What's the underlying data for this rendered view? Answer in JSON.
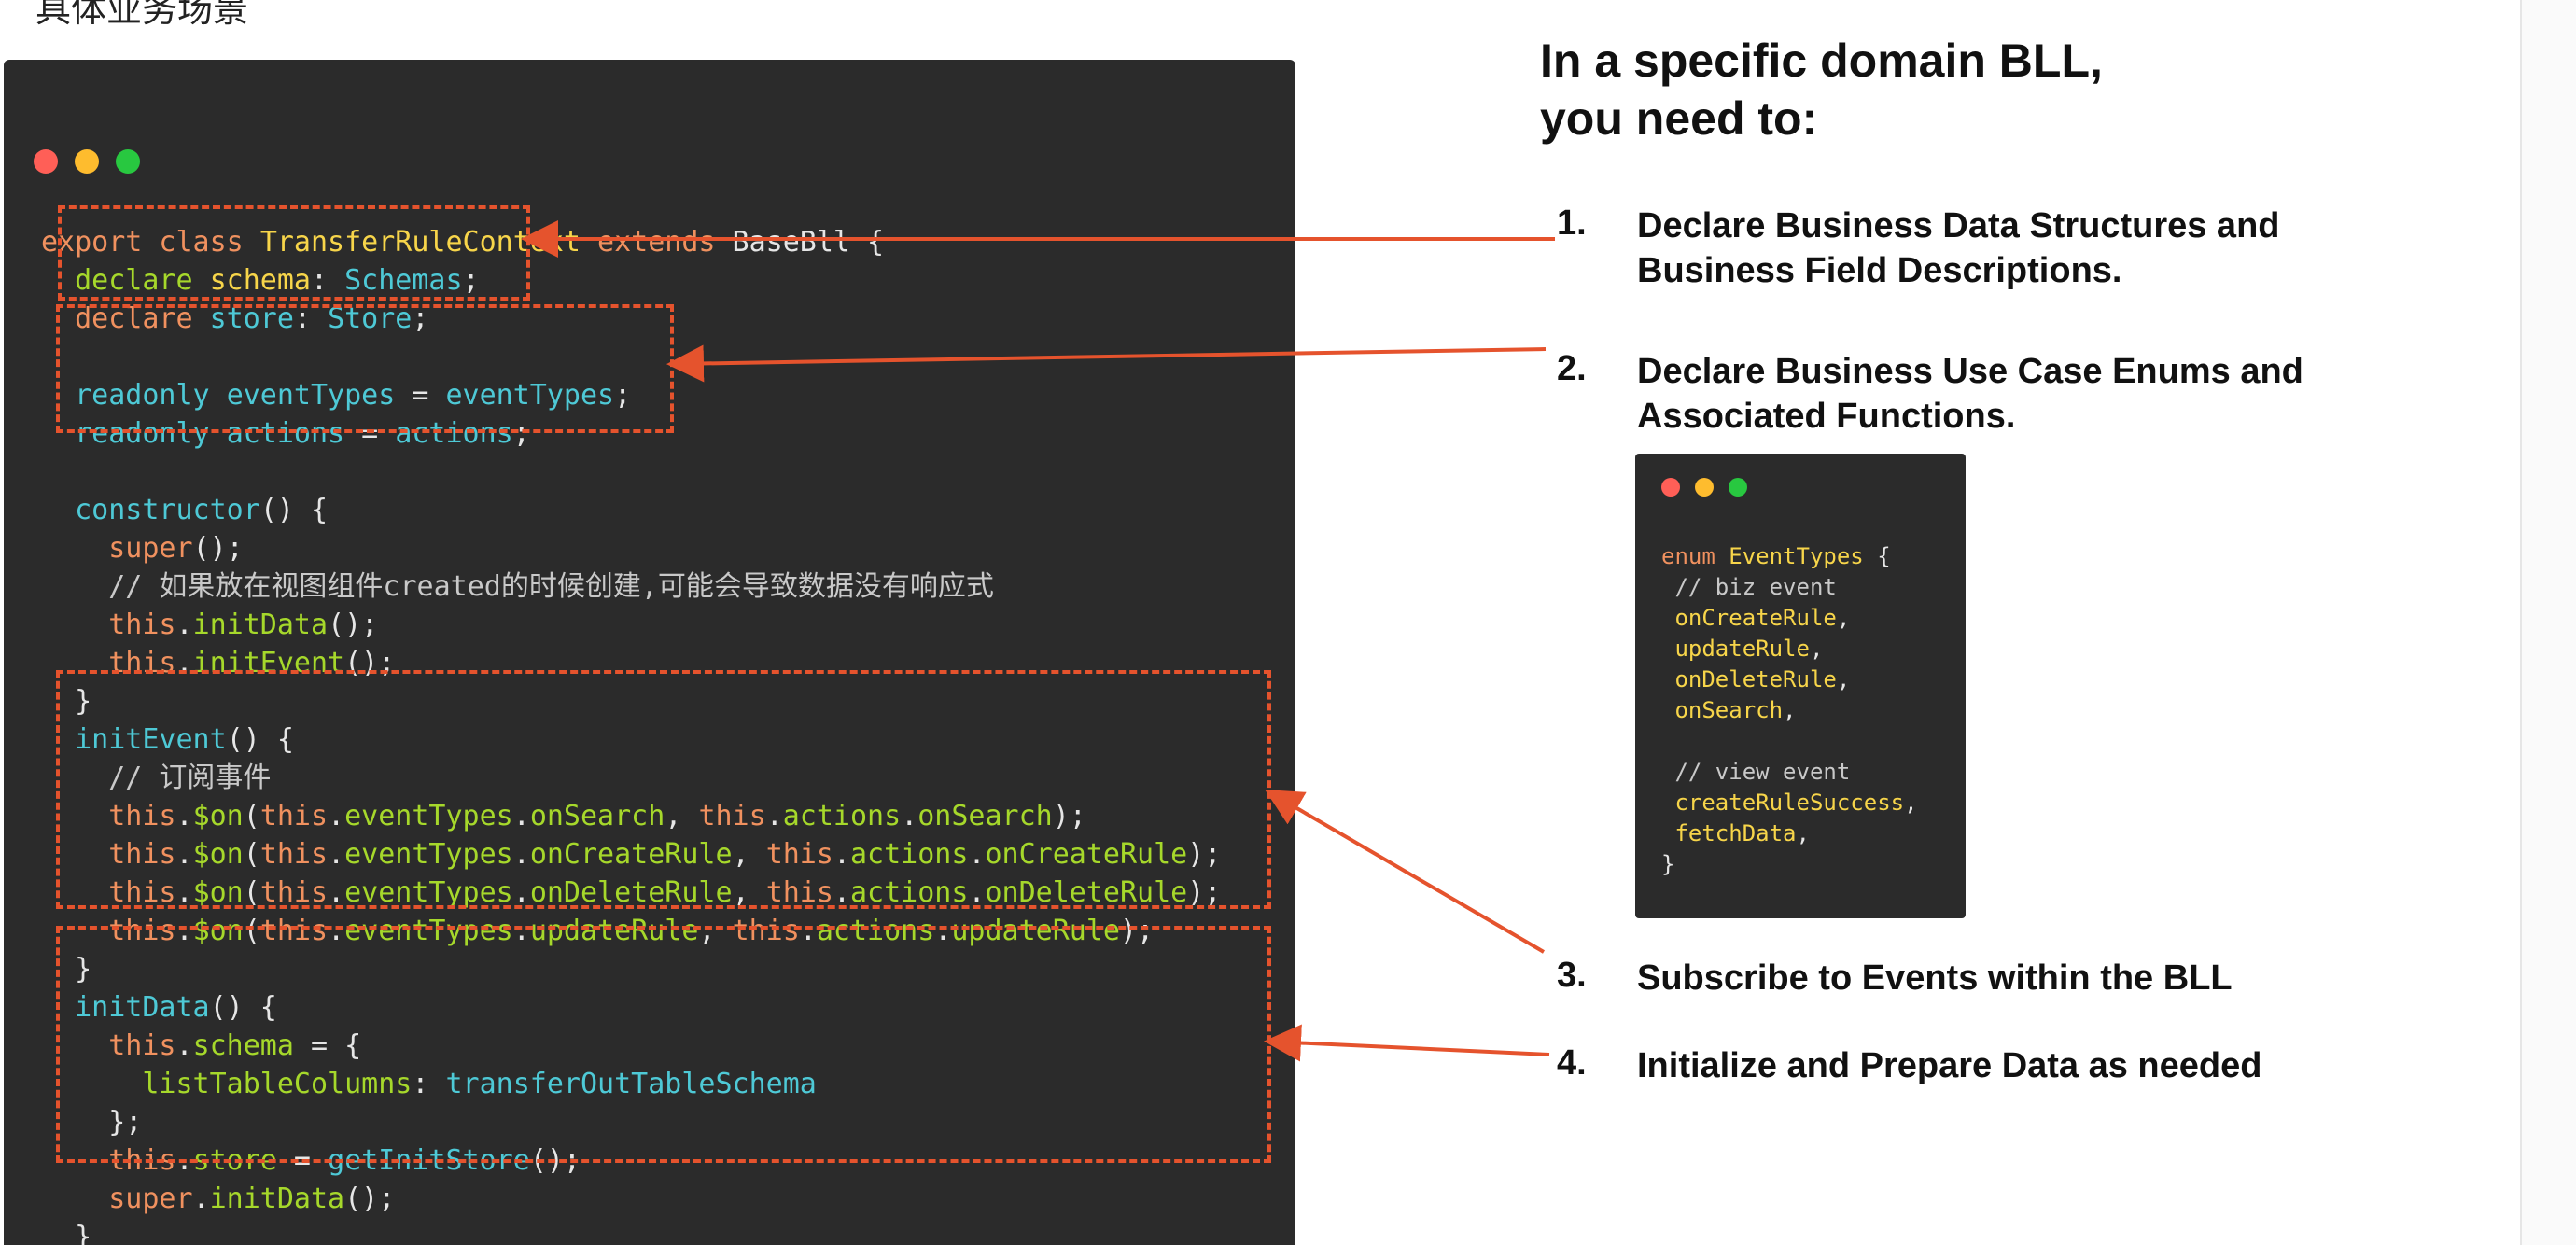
{
  "scene_title": "具体业务场景",
  "code_window": {
    "dot_colors": [
      "#ff5f57",
      "#febc2e",
      "#28c840"
    ],
    "lines": [
      [
        {
          "t": "export class ",
          "c": "kw"
        },
        {
          "t": "TransferRuleContext",
          "c": "cls"
        },
        {
          "t": " extends ",
          "c": "kw"
        },
        {
          "t": "BaseBll {",
          "c": "pun"
        }
      ],
      [
        {
          "t": "  declare ",
          "c": "gr"
        },
        {
          "t": "schema",
          "c": "cls"
        },
        {
          "t": ": ",
          "c": "pun"
        },
        {
          "t": "Schemas",
          "c": "id"
        },
        {
          "t": ";",
          "c": "pun"
        }
      ],
      [
        {
          "t": "  declare ",
          "c": "kw"
        },
        {
          "t": "store",
          "c": "id"
        },
        {
          "t": ": ",
          "c": "pun"
        },
        {
          "t": "Store",
          "c": "id"
        },
        {
          "t": ";",
          "c": "pun"
        }
      ],
      [
        {
          "t": "",
          "c": "pun"
        }
      ],
      [
        {
          "t": "  readonly ",
          "c": "id"
        },
        {
          "t": "eventTypes",
          "c": "id"
        },
        {
          "t": " = ",
          "c": "pun"
        },
        {
          "t": "eventTypes",
          "c": "id"
        },
        {
          "t": ";",
          "c": "pun"
        }
      ],
      [
        {
          "t": "  readonly ",
          "c": "id"
        },
        {
          "t": "actions",
          "c": "id"
        },
        {
          "t": " = ",
          "c": "pun"
        },
        {
          "t": "actions",
          "c": "id"
        },
        {
          "t": ";",
          "c": "pun"
        }
      ],
      [
        {
          "t": "",
          "c": "pun"
        }
      ],
      [
        {
          "t": "  constructor",
          "c": "id"
        },
        {
          "t": "() {",
          "c": "pun"
        }
      ],
      [
        {
          "t": "    super",
          "c": "kw"
        },
        {
          "t": "();",
          "c": "pun"
        }
      ],
      [
        {
          "t": "    // 如果放在视图组件created的时候创建,可能会导致数据没有响应式",
          "c": "cm"
        }
      ],
      [
        {
          "t": "    this",
          "c": "kw"
        },
        {
          "t": ".",
          "c": "pun"
        },
        {
          "t": "initData",
          "c": "gr"
        },
        {
          "t": "();",
          "c": "pun"
        }
      ],
      [
        {
          "t": "    this",
          "c": "kw"
        },
        {
          "t": ".",
          "c": "pun"
        },
        {
          "t": "initEvent",
          "c": "gr"
        },
        {
          "t": "();",
          "c": "pun"
        }
      ],
      [
        {
          "t": "  }",
          "c": "pun"
        }
      ],
      [
        {
          "t": "  initEvent",
          "c": "id"
        },
        {
          "t": "() {",
          "c": "pun"
        }
      ],
      [
        {
          "t": "    // 订阅事件",
          "c": "cm"
        }
      ],
      [
        {
          "t": "    this",
          "c": "kw"
        },
        {
          "t": ".",
          "c": "pun"
        },
        {
          "t": "$on",
          "c": "gr"
        },
        {
          "t": "(",
          "c": "pun"
        },
        {
          "t": "this",
          "c": "kw"
        },
        {
          "t": ".",
          "c": "pun"
        },
        {
          "t": "eventTypes",
          "c": "gr"
        },
        {
          "t": ".",
          "c": "pun"
        },
        {
          "t": "onSearch",
          "c": "gr"
        },
        {
          "t": ", ",
          "c": "pun"
        },
        {
          "t": "this",
          "c": "kw"
        },
        {
          "t": ".",
          "c": "pun"
        },
        {
          "t": "actions",
          "c": "gr"
        },
        {
          "t": ".",
          "c": "pun"
        },
        {
          "t": "onSearch",
          "c": "gr"
        },
        {
          "t": ");",
          "c": "pun"
        }
      ],
      [
        {
          "t": "    this",
          "c": "kw"
        },
        {
          "t": ".",
          "c": "pun"
        },
        {
          "t": "$on",
          "c": "gr"
        },
        {
          "t": "(",
          "c": "pun"
        },
        {
          "t": "this",
          "c": "kw"
        },
        {
          "t": ".",
          "c": "pun"
        },
        {
          "t": "eventTypes",
          "c": "gr"
        },
        {
          "t": ".",
          "c": "pun"
        },
        {
          "t": "onCreateRule",
          "c": "gr"
        },
        {
          "t": ", ",
          "c": "pun"
        },
        {
          "t": "this",
          "c": "kw"
        },
        {
          "t": ".",
          "c": "pun"
        },
        {
          "t": "actions",
          "c": "gr"
        },
        {
          "t": ".",
          "c": "pun"
        },
        {
          "t": "onCreateRule",
          "c": "gr"
        },
        {
          "t": ");",
          "c": "pun"
        }
      ],
      [
        {
          "t": "    this",
          "c": "kw"
        },
        {
          "t": ".",
          "c": "pun"
        },
        {
          "t": "$on",
          "c": "gr"
        },
        {
          "t": "(",
          "c": "pun"
        },
        {
          "t": "this",
          "c": "kw"
        },
        {
          "t": ".",
          "c": "pun"
        },
        {
          "t": "eventTypes",
          "c": "gr"
        },
        {
          "t": ".",
          "c": "pun"
        },
        {
          "t": "onDeleteRule",
          "c": "gr"
        },
        {
          "t": ", ",
          "c": "pun"
        },
        {
          "t": "this",
          "c": "kw"
        },
        {
          "t": ".",
          "c": "pun"
        },
        {
          "t": "actions",
          "c": "gr"
        },
        {
          "t": ".",
          "c": "pun"
        },
        {
          "t": "onDeleteRule",
          "c": "gr"
        },
        {
          "t": ");",
          "c": "pun"
        }
      ],
      [
        {
          "t": "    this",
          "c": "kw"
        },
        {
          "t": ".",
          "c": "pun"
        },
        {
          "t": "$on",
          "c": "gr"
        },
        {
          "t": "(",
          "c": "pun"
        },
        {
          "t": "this",
          "c": "kw"
        },
        {
          "t": ".",
          "c": "pun"
        },
        {
          "t": "eventTypes",
          "c": "gr"
        },
        {
          "t": ".",
          "c": "pun"
        },
        {
          "t": "updateRule",
          "c": "gr"
        },
        {
          "t": ", ",
          "c": "pun"
        },
        {
          "t": "this",
          "c": "kw"
        },
        {
          "t": ".",
          "c": "pun"
        },
        {
          "t": "actions",
          "c": "gr"
        },
        {
          "t": ".",
          "c": "pun"
        },
        {
          "t": "updateRule",
          "c": "gr"
        },
        {
          "t": ");",
          "c": "pun"
        }
      ],
      [
        {
          "t": "  }",
          "c": "pun"
        }
      ],
      [
        {
          "t": "  initData",
          "c": "id"
        },
        {
          "t": "() {",
          "c": "pun"
        }
      ],
      [
        {
          "t": "    this",
          "c": "kw"
        },
        {
          "t": ".",
          "c": "pun"
        },
        {
          "t": "schema",
          "c": "gr"
        },
        {
          "t": " = {",
          "c": "pun"
        }
      ],
      [
        {
          "t": "      listTableColumns",
          "c": "gr"
        },
        {
          "t": ": ",
          "c": "pun"
        },
        {
          "t": "transferOutTableSchema",
          "c": "id"
        }
      ],
      [
        {
          "t": "    };",
          "c": "pun"
        }
      ],
      [
        {
          "t": "    this",
          "c": "kw"
        },
        {
          "t": ".",
          "c": "pun"
        },
        {
          "t": "store",
          "c": "gr"
        },
        {
          "t": " = ",
          "c": "pun"
        },
        {
          "t": "getInitStore",
          "c": "id"
        },
        {
          "t": "();",
          "c": "pun"
        }
      ],
      [
        {
          "t": "    super",
          "c": "kw"
        },
        {
          "t": ".",
          "c": "pun"
        },
        {
          "t": "initData",
          "c": "gr"
        },
        {
          "t": "();",
          "c": "pun"
        }
      ],
      [
        {
          "t": "  }",
          "c": "pun"
        }
      ],
      [
        {
          "t": "}",
          "c": "pun"
        }
      ]
    ]
  },
  "right_panel": {
    "title_lines": [
      "In a specific domain BLL,",
      "you need to:"
    ],
    "steps": [
      {
        "num": "1.",
        "lines": [
          "Declare Business Data Structures and",
          "Business Field Descriptions."
        ]
      },
      {
        "num": "2.",
        "lines": [
          "Declare Business Use Case Enums and",
          "Associated Functions."
        ]
      },
      {
        "num": "3.",
        "lines": [
          "Subscribe to Events within the BLL"
        ]
      },
      {
        "num": "4.",
        "lines": [
          "Initialize and Prepare Data as needed"
        ]
      }
    ]
  },
  "mini_code": {
    "dot_colors": [
      "#ff5f57",
      "#febc2e",
      "#28c840"
    ],
    "lines": [
      [
        {
          "t": "enum ",
          "c": "kw"
        },
        {
          "t": "EventTypes",
          "c": "cls"
        },
        {
          "t": " {",
          "c": "pun"
        }
      ],
      [
        {
          "t": " // biz event",
          "c": "cm"
        }
      ],
      [
        {
          "t": " onCreateRule",
          "c": "cls"
        },
        {
          "t": ",",
          "c": "pun"
        }
      ],
      [
        {
          "t": " updateRule",
          "c": "cls"
        },
        {
          "t": ",",
          "c": "pun"
        }
      ],
      [
        {
          "t": " onDeleteRule",
          "c": "cls"
        },
        {
          "t": ",",
          "c": "pun"
        }
      ],
      [
        {
          "t": " onSearch",
          "c": "cls"
        },
        {
          "t": ",",
          "c": "pun"
        }
      ],
      [
        {
          "t": "",
          "c": "pun"
        }
      ],
      [
        {
          "t": " // view event",
          "c": "cm"
        }
      ],
      [
        {
          "t": " createRuleSuccess",
          "c": "cls"
        },
        {
          "t": ",",
          "c": "pun"
        }
      ],
      [
        {
          "t": " fetchData",
          "c": "cls"
        },
        {
          "t": ",",
          "c": "pun"
        }
      ],
      [
        {
          "t": "}",
          "c": "pun"
        }
      ]
    ]
  },
  "colors": {
    "annotation": "#e5532d",
    "code_bg": "#2b2b2b"
  }
}
